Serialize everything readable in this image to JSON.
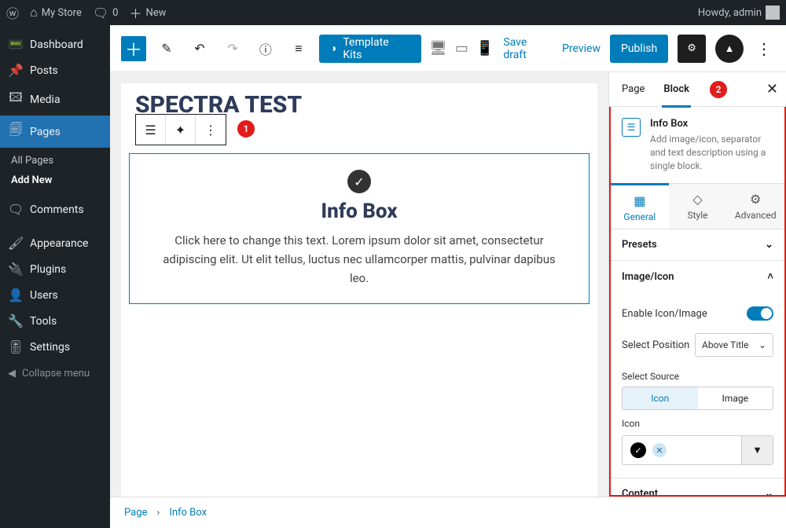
{
  "adminbar": {
    "site": "My Store",
    "comments": "0",
    "new": "New",
    "howdy": "Howdy, admin"
  },
  "sidebar": {
    "items": [
      {
        "label": "Dashboard"
      },
      {
        "label": "Posts"
      },
      {
        "label": "Media"
      },
      {
        "label": "Pages"
      },
      {
        "label": "Comments"
      },
      {
        "label": "Appearance"
      },
      {
        "label": "Plugins"
      },
      {
        "label": "Users"
      },
      {
        "label": "Tools"
      },
      {
        "label": "Settings"
      }
    ],
    "pages_sub": {
      "all": "All Pages",
      "add": "Add New"
    },
    "collapse": "Collapse menu"
  },
  "toolbar": {
    "template_kits": "Template Kits",
    "save_draft": "Save draft",
    "preview": "Preview",
    "publish": "Publish"
  },
  "canvas": {
    "title": "SPECTRA TEST",
    "infobox": {
      "heading": "Info Box",
      "desc": "Click here to change this text. Lorem ipsum dolor sit amet, consectetur adipiscing elit. Ut elit tellus, luctus nec ullamcorper mattis, pulvinar dapibus leo."
    }
  },
  "breadcrumb": {
    "root": "Page",
    "leaf": "Info Box",
    "sep": "›"
  },
  "settings": {
    "tabs": {
      "page": "Page",
      "block": "Block"
    },
    "block_meta": {
      "name": "Info Box",
      "desc": "Add image/icon, separator and text description using a single block."
    },
    "ctl_tabs": {
      "general": "General",
      "style": "Style",
      "advanced": "Advanced"
    },
    "sections": {
      "presets": "Presets",
      "image_icon": "Image/Icon",
      "content": "Content"
    },
    "image_icon": {
      "enable_label": "Enable Icon/Image",
      "position_label": "Select Position",
      "position_value": "Above Title",
      "source_label": "Select Source",
      "source_icon": "Icon",
      "source_image": "Image",
      "icon_label": "Icon"
    }
  },
  "annotations": {
    "one": "1",
    "two": "2"
  }
}
